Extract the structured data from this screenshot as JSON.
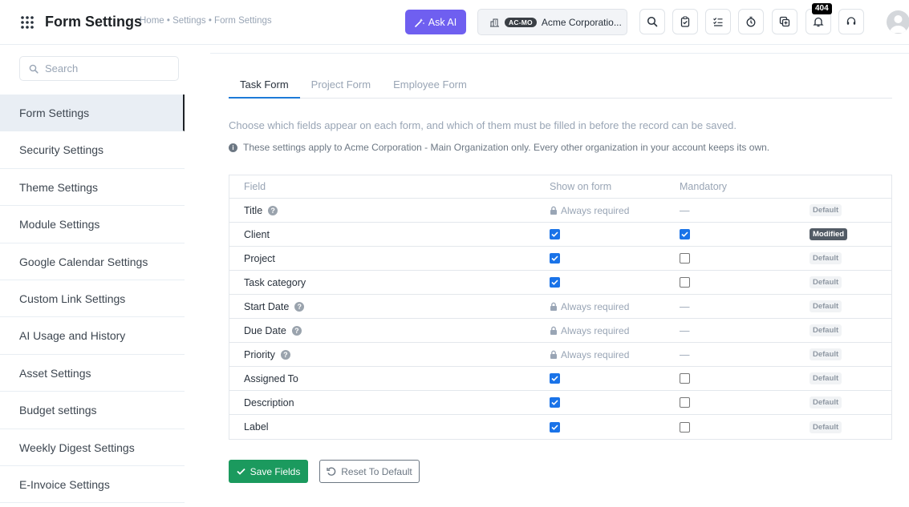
{
  "header": {
    "title": "Form Settings",
    "breadcrumb": "Home • Settings • Form Settings",
    "ask_ai_label": "Ask AI",
    "org_badge": "AC-MO",
    "org_name": "Acme Corporatio...",
    "notification_count": "404"
  },
  "sidebar": {
    "search_placeholder": "Search",
    "items": [
      {
        "label": "Form Settings"
      },
      {
        "label": "Security Settings"
      },
      {
        "label": "Theme Settings"
      },
      {
        "label": "Module Settings"
      },
      {
        "label": "Google Calendar Settings"
      },
      {
        "label": "Custom Link Settings"
      },
      {
        "label": "AI Usage and History"
      },
      {
        "label": "Asset Settings"
      },
      {
        "label": "Budget settings"
      },
      {
        "label": "Weekly Digest Settings"
      },
      {
        "label": "E-Invoice Settings"
      }
    ]
  },
  "main": {
    "tabs": [
      {
        "label": "Task Form"
      },
      {
        "label": "Project Form"
      },
      {
        "label": "Employee Form"
      }
    ],
    "description": "Choose which fields appear on each form, and which of them must be filled in before the record can be saved.",
    "note": "These settings apply to Acme Corporation - Main Organization only. Every other organization in your account keeps its own.",
    "table": {
      "headers": {
        "field": "Field",
        "show": "Show on form",
        "mandatory": "Mandatory"
      },
      "always_required_label": "Always required",
      "dash": "—",
      "rows": [
        {
          "field": "Title",
          "help": true,
          "always": true,
          "show": true,
          "mandatory": false,
          "badge": "Default"
        },
        {
          "field": "Client",
          "help": false,
          "always": false,
          "show": true,
          "mandatory": true,
          "badge": "Modified"
        },
        {
          "field": "Project",
          "help": false,
          "always": false,
          "show": true,
          "mandatory": false,
          "badge": "Default"
        },
        {
          "field": "Task category",
          "help": false,
          "always": false,
          "show": true,
          "mandatory": false,
          "badge": "Default"
        },
        {
          "field": "Start Date",
          "help": true,
          "always": true,
          "show": true,
          "mandatory": false,
          "badge": "Default"
        },
        {
          "field": "Due Date",
          "help": true,
          "always": true,
          "show": true,
          "mandatory": false,
          "badge": "Default"
        },
        {
          "field": "Priority",
          "help": true,
          "always": true,
          "show": true,
          "mandatory": false,
          "badge": "Default"
        },
        {
          "field": "Assigned To",
          "help": false,
          "always": false,
          "show": true,
          "mandatory": false,
          "badge": "Default"
        },
        {
          "field": "Description",
          "help": false,
          "always": false,
          "show": true,
          "mandatory": false,
          "badge": "Default"
        },
        {
          "field": "Label",
          "help": false,
          "always": false,
          "show": true,
          "mandatory": false,
          "badge": "Default"
        }
      ]
    },
    "save_label": "Save Fields",
    "reset_label": "Reset To Default"
  },
  "colors": {
    "ask_ai": "#6f5ff0",
    "save": "#1b9a5e",
    "checkbox": "#1a73e8",
    "active_tab": "#1d7bd8"
  }
}
